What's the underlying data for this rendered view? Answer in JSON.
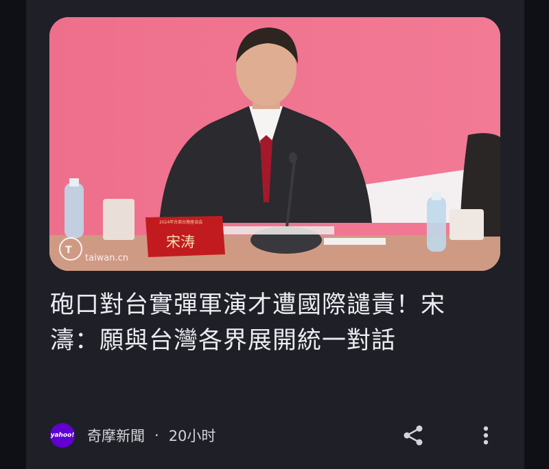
{
  "hero": {
    "watermark": "taiwan.cn",
    "nameplate": "宋涛",
    "nameplate_header": "2024年台商台胞座谈会"
  },
  "article": {
    "headline": "砲口對台實彈軍演才遭國際譴責！宋濤：願與台灣各界展開統一對話"
  },
  "meta": {
    "source_logo_text": "yahoo!",
    "source": "奇摩新聞",
    "separator": "·",
    "time": "20小时"
  },
  "icons": {
    "share": "share-icon",
    "more": "more-vertical-icon"
  },
  "colors": {
    "background": "#0f1015",
    "card": "#1f2027",
    "headline_text": "#ececf0",
    "hero_backdrop": "#f0718f",
    "yahoo_purple": "#6001d2"
  }
}
